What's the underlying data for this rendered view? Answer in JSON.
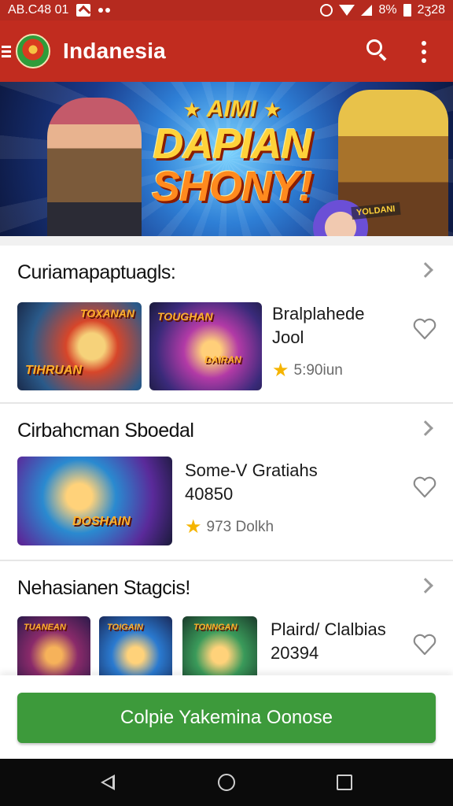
{
  "status_bar": {
    "time_text": "AB.C48 01",
    "battery_text": "8%",
    "clock_right": "2ʒ28",
    "icons": [
      "app-notification-icon",
      "dots-icon",
      "alarm-icon",
      "wifi-icon",
      "signal-icon",
      "battery-icon"
    ]
  },
  "app_bar": {
    "title": "Indanesia",
    "icons": [
      "menu-icon",
      "app-logo",
      "search-icon",
      "more-vert-icon"
    ]
  },
  "banner": {
    "line1": "AIMI",
    "line2": "DAPIAN",
    "line3": "SHONY!",
    "badge": "YOLDANI"
  },
  "sections": [
    {
      "title": "Curiamapaptuagls:",
      "thumbs": [
        "TOXANAN",
        "TOUGHAN"
      ],
      "thumb_subs": [
        "TIHRUAN",
        "DAIRAN"
      ],
      "item_name_1": "Bralplahede",
      "item_name_2": "Jool",
      "rating": "5:90iun"
    },
    {
      "title": "Cirbahcman Sboedal",
      "thumbs": [
        "DOSHAIN"
      ],
      "item_name_1": "Some-V Gratiahs",
      "item_name_2": "40850",
      "rating": "973 Dolkh"
    },
    {
      "title": "Nehasianen Stagcis!",
      "thumbs": [
        "TUANEAN",
        "TOIGAIN",
        "TONNGAN"
      ],
      "item_name_1": "Plaird/ Clalbias",
      "item_name_2": "20394"
    }
  ],
  "cta": {
    "label": "Colpie Yakemina Oonose"
  },
  "nav_bar": {
    "icons": [
      "back-icon",
      "home-icon",
      "recents-icon"
    ]
  },
  "colors": {
    "app_bar": "#c12c1f",
    "status_bar": "#b52a1f",
    "cta": "#3d9a3b",
    "star": "#f5b400"
  }
}
